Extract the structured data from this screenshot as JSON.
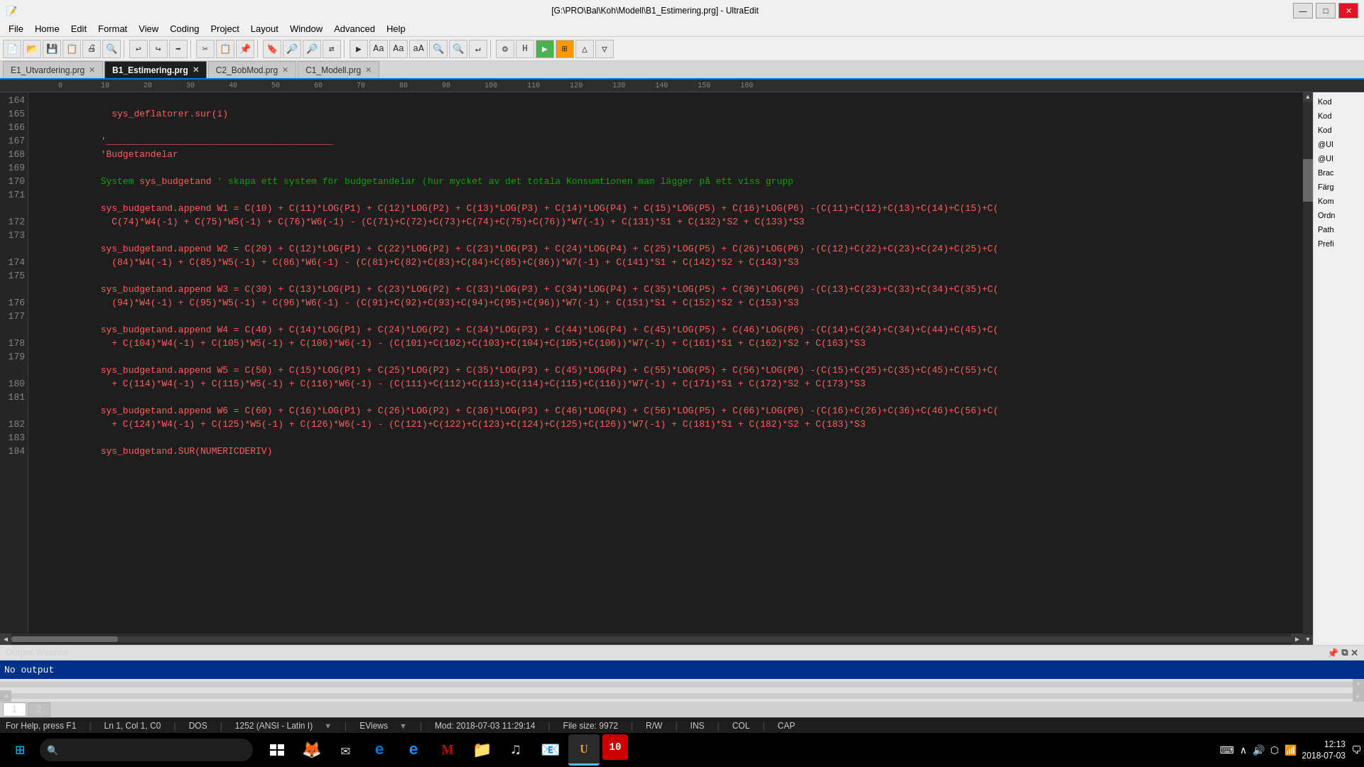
{
  "titlebar": {
    "title": "[G:\\PRO\\Bal\\Koh\\Modell\\B1_Estimering.prg] - UltraEdit",
    "minimize": "—",
    "maximize": "□",
    "close": "✕"
  },
  "menubar": {
    "items": [
      "File",
      "Home",
      "Edit",
      "Format",
      "View",
      "Coding",
      "Project",
      "Layout",
      "Window",
      "Advanced",
      "Help"
    ]
  },
  "tabs": [
    {
      "label": "E1_Utvardering.prg",
      "active": false
    },
    {
      "label": "B1_Estimering.prg",
      "active": true
    },
    {
      "label": "C2_BobMod.prg",
      "active": false
    },
    {
      "label": "C1_Modell.prg",
      "active": false
    }
  ],
  "right_panel": {
    "items": [
      "Kod",
      "Kod",
      "Kod",
      "@UI",
      "@UI",
      "Brac",
      "Färg",
      "Kom",
      "Ordn",
      "Path",
      "Prefi"
    ]
  },
  "code_lines": [
    {
      "num": "164",
      "content": "  sys_deflatorer.sur(i)"
    },
    {
      "num": "165",
      "content": ""
    },
    {
      "num": "166",
      "content": "'_________________________________________"
    },
    {
      "num": "167",
      "content": "'Budgetandelar"
    },
    {
      "num": "168",
      "content": ""
    },
    {
      "num": "169",
      "content": "System sys_budgetand ' skapa ett system för budgetandelar (hur mycket av det totala Konsumtionen man lägger på ett viss grupp"
    },
    {
      "num": "170",
      "content": ""
    },
    {
      "num": "171",
      "content": "sys_budgetand.append W1 = C(10) + C(11)*LOG(P1) + C(12)*LOG(P2) + C(13)*LOG(P3) + C(14)*LOG(P4) + C(15)*LOG(P5) + C(16)*LOG(P6) -(C(11)+C(12)+C(13)+C(14)+C(15)+C("
    },
    {
      "num": "   ",
      "content": "  C(74)*W4(-1) + C(75)*W5(-1) + C(76)*W6(-1) - (C(71)+C(72)+C(73)+C(74)+C(75)+C(76))*W7(-1) + C(131)*S1 + C(132)*S2 + C(133)*S3"
    },
    {
      "num": "172",
      "content": ""
    },
    {
      "num": "173",
      "content": "sys_budgetand.append W2 = C(20) + C(12)*LOG(P1) + C(22)*LOG(P2) + C(23)*LOG(P3) + C(24)*LOG(P4) + C(25)*LOG(P5) + C(26)*LOG(P6) -(C(12)+C(22)+C(23)+C(24)+C(25)+C("
    },
    {
      "num": "   ",
      "content": "  (84)*W4(-1) + C(85)*W5(-1) + C(86)*W6(-1) - (C(81)+C(82)+C(83)+C(84)+C(85)+C(86))*W7(-1) + C(141)*S1 + C(142)*S2 + C(143)*S3"
    },
    {
      "num": "174",
      "content": ""
    },
    {
      "num": "175",
      "content": "sys_budgetand.append W3 = C(30) + C(13)*LOG(P1) + C(23)*LOG(P2) + C(33)*LOG(P3) + C(34)*LOG(P4) + C(35)*LOG(P5) + C(36)*LOG(P6) -(C(13)+C(23)+C(33)+C(34)+C(35)+C("
    },
    {
      "num": "   ",
      "content": "  (94)*W4(-1) + C(95)*W5(-1) + C(96)*W6(-1) - (C(91)+C(92)+C(93)+C(94)+C(95)+C(96))*W7(-1) + C(151)*S1 + C(152)*S2 + C(153)*S3"
    },
    {
      "num": "176",
      "content": ""
    },
    {
      "num": "177",
      "content": "sys_budgetand.append W4 = C(40) + C(14)*LOG(P1) + C(24)*LOG(P2) + C(34)*LOG(P3) + C(44)*LOG(P4) + C(45)*LOG(P5) + C(46)*LOG(P6) -(C(14)+C(24)+C(34)+C(44)+C(45)+C("
    },
    {
      "num": "   ",
      "content": "  + C(104)*W4(-1) + C(105)*W5(-1) + C(106)*W6(-1) - (C(101)+C(102)+C(103)+C(104)+C(105)+C(106))*W7(-1) + C(161)*S1 + C(162)*S2 + C(163)*S3"
    },
    {
      "num": "178",
      "content": ""
    },
    {
      "num": "179",
      "content": "sys_budgetand.append W5 = C(50) + C(15)*LOG(P1) + C(25)*LOG(P2) + C(35)*LOG(P3) + C(45)*LOG(P4) + C(55)*LOG(P5) + C(56)*LOG(P6) -(C(15)+C(25)+C(35)+C(45)+C(55)+C("
    },
    {
      "num": "   ",
      "content": "  + C(114)*W4(-1) + C(115)*W5(-1) + C(116)*W6(-1) - (C(111)+C(112)+C(113)+C(114)+C(115)+C(116))*W7(-1) + C(171)*S1 + C(172)*S2 + C(173)*S3"
    },
    {
      "num": "180",
      "content": ""
    },
    {
      "num": "181",
      "content": "sys_budgetand.append W6 = C(60) + C(16)*LOG(P1) + C(26)*LOG(P2) + C(36)*LOG(P3) + C(46)*LOG(P4) + C(56)*LOG(P5) + C(66)*LOG(P6) -(C(16)+C(26)+C(36)+C(46)+C(56)+C("
    },
    {
      "num": "   ",
      "content": "  + C(124)*W4(-1) + C(125)*W5(-1) + C(126)*W6(-1) - (C(121)+C(122)+C(123)+C(124)+C(125)+C(126))*W7(-1) + C(181)*S1 + C(182)*S2 + C(183)*S3"
    },
    {
      "num": "182",
      "content": ""
    },
    {
      "num": "183",
      "content": "sys_budgetand.SUR(NUMERICDERIV)"
    },
    {
      "num": "184",
      "content": ""
    }
  ],
  "output_window": {
    "title": "Output Window",
    "content": "No output",
    "tabs": [
      "1",
      "2"
    ]
  },
  "statusbar": {
    "help": "For Help, press F1",
    "position": "Ln 1, Col 1, C0",
    "format": "DOS",
    "code": "1252  (ANSI - Latin I)",
    "view": "EViews",
    "modified": "Mod: 2018-07-03 11:29:14",
    "filesize": "File size: 9972",
    "rw": "R/W",
    "ins": "INS",
    "col": "COL",
    "cap": "CAP"
  },
  "taskbar": {
    "apps": [
      {
        "icon": "⊞",
        "name": "start"
      },
      {
        "icon": "🔍",
        "name": "search"
      },
      {
        "icon": "⬛",
        "name": "taskview"
      },
      {
        "icon": "🦊",
        "name": "firefox"
      },
      {
        "icon": "✉",
        "name": "mail"
      },
      {
        "icon": "🌐",
        "name": "edge"
      },
      {
        "icon": "🌐",
        "name": "ie"
      },
      {
        "icon": "M",
        "name": "maven"
      },
      {
        "icon": "📁",
        "name": "explorer"
      },
      {
        "icon": "♫",
        "name": "spotify"
      },
      {
        "icon": "📧",
        "name": "email2"
      },
      {
        "icon": "U",
        "name": "ultraedit"
      },
      {
        "icon": "10",
        "name": "app10"
      }
    ],
    "time": "12:13",
    "date": "2018-07-03"
  }
}
